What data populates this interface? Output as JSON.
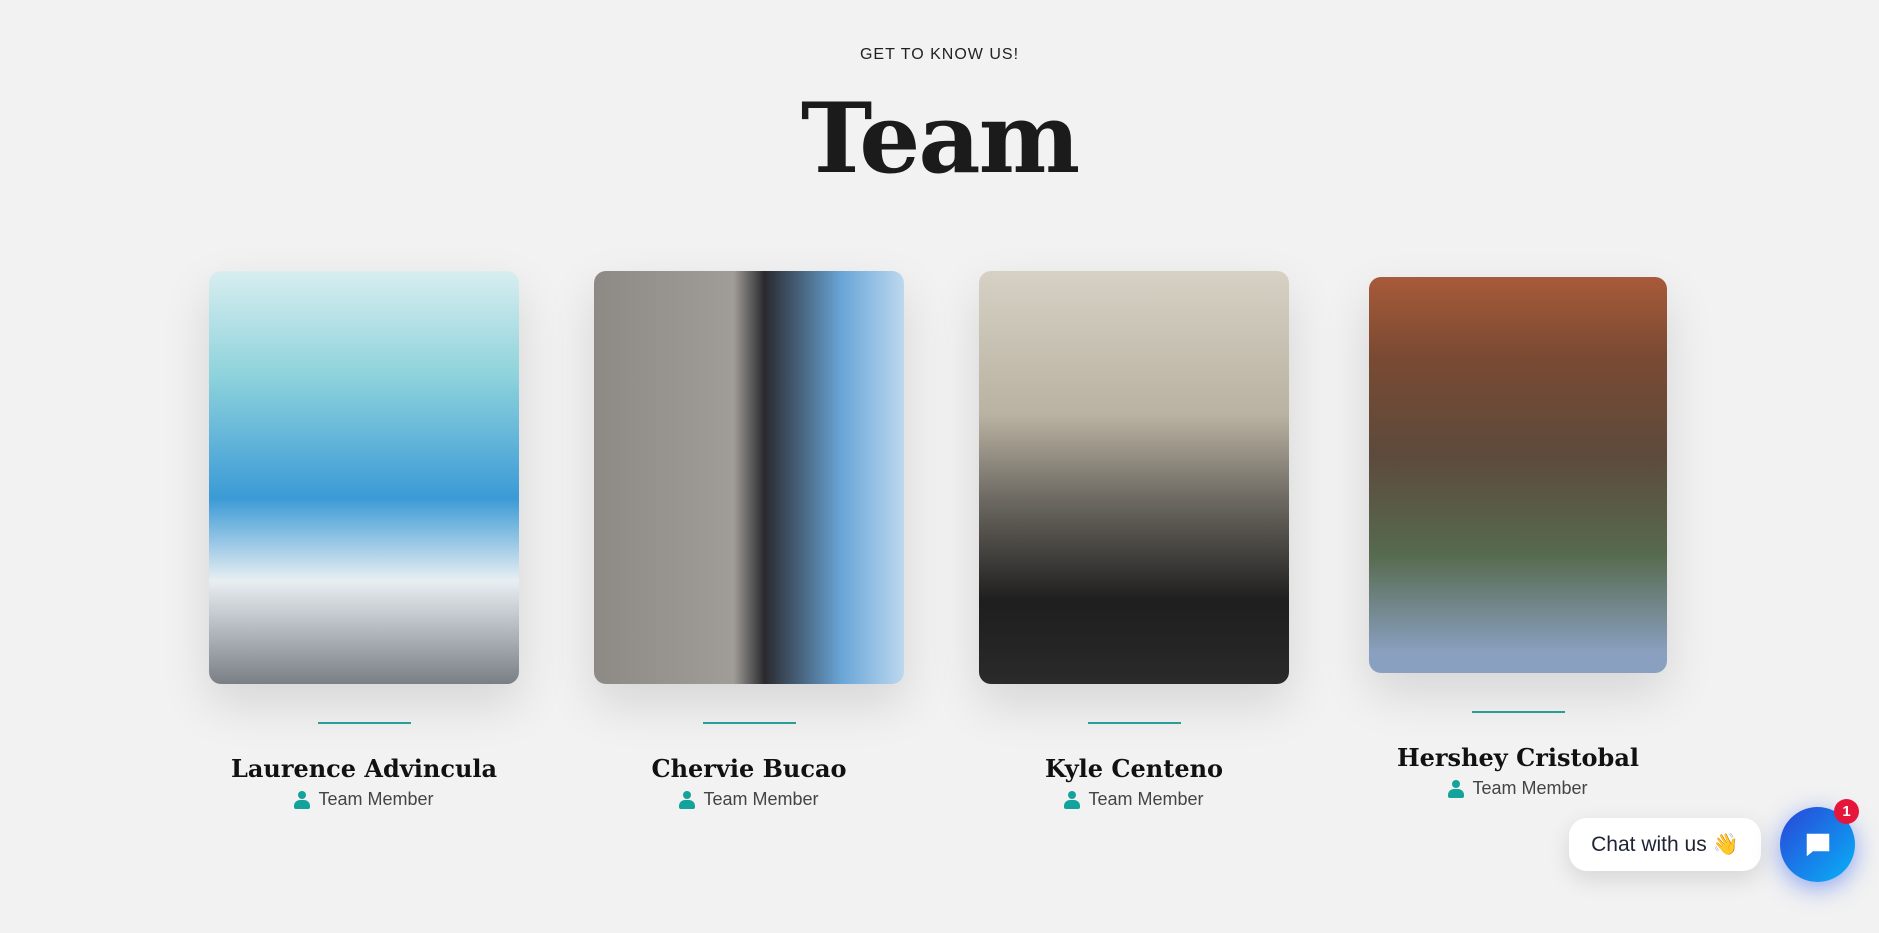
{
  "header": {
    "eyebrow": "GET TO KNOW US!",
    "title": "Team"
  },
  "team": [
    {
      "name": "Laurence Advincula",
      "role": "Team Member"
    },
    {
      "name": "Chervie Bucao",
      "role": "Team Member"
    },
    {
      "name": "Kyle Centeno",
      "role": "Team Member"
    },
    {
      "name": "Hershey Cristobal",
      "role": "Team Member"
    }
  ],
  "chat": {
    "label": "Chat with us",
    "emoji": "👋",
    "badge": "1"
  }
}
